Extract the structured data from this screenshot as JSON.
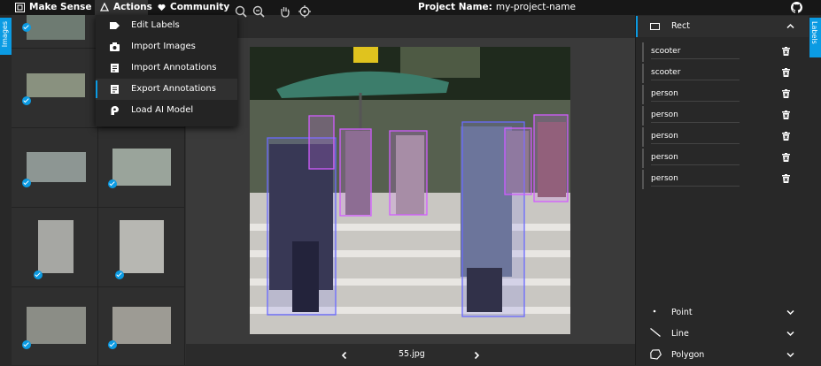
{
  "topbar": {
    "brand": "Make Sense",
    "actions": "Actions",
    "community": "Community",
    "project_label": "Project Name:",
    "project_name": "my-project-name"
  },
  "side_tabs": {
    "left": "Images",
    "right": "Labels"
  },
  "actions_menu": {
    "items": [
      {
        "label": "Edit Labels",
        "icon": "label-tag-icon"
      },
      {
        "label": "Import Images",
        "icon": "camera-icon"
      },
      {
        "label": "Import Annotations",
        "icon": "document-icon"
      },
      {
        "label": "Export Annotations",
        "icon": "document-icon",
        "active": true
      },
      {
        "label": "Load AI Model",
        "icon": "ai-brain-icon"
      }
    ]
  },
  "workspace": {
    "file_name": "55.jpg"
  },
  "labels_panel": {
    "rect_header": "Rect",
    "labels": [
      "scooter",
      "scooter",
      "person",
      "person",
      "person",
      "person",
      "person"
    ],
    "tools": [
      "Point",
      "Line",
      "Polygon"
    ]
  },
  "colors": {
    "accent": "#0b9be3",
    "topbar": "#171717",
    "panel": "#282828"
  }
}
